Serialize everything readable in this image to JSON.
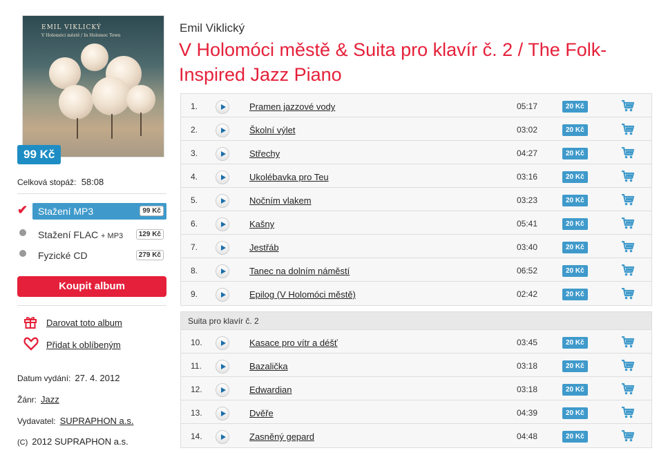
{
  "album": {
    "artist": "Emil Viklický",
    "title": "V Holomóci městě & Suita pro klavír č. 2 / The Folk-Inspired Jazz Piano",
    "price": "99 Kč",
    "cover": {
      "artist_text": "EMIL VIKLICKÝ",
      "subtitle_text": "V Holomóci městě / In Holomoc Town"
    },
    "duration_label": "Celková stopáž:",
    "duration_value": "58:08"
  },
  "formats": [
    {
      "label": "Stažení MP3",
      "suffix": "",
      "price": "99 Kč",
      "selected": true
    },
    {
      "label": "Stažení FLAC",
      "suffix": "+ MP3",
      "price": "129 Kč",
      "selected": false
    },
    {
      "label": "Fyzické CD",
      "suffix": "",
      "price": "279 Kč",
      "selected": false
    }
  ],
  "buy_label": "Koupit album",
  "actions": {
    "gift_label": "Darovat toto album",
    "favorite_label": "Přidat k oblíbeným"
  },
  "meta": {
    "release_label": "Datum vydání:",
    "release_value": "27. 4. 2012",
    "genre_label": "Žánr:",
    "genre_value": "Jazz",
    "publisher_label": "Vydavatel:",
    "publisher_value": "SUPRAPHON a.s.",
    "copyright_symbol": "(C)",
    "copyright_value": "2012 SUPRAPHON a.s."
  },
  "tracks_part1": [
    {
      "no": "1.",
      "name": "Pramen jazzové vody",
      "time": "05:17",
      "price": "20 Kč"
    },
    {
      "no": "2.",
      "name": "Školní výlet",
      "time": "03:02",
      "price": "20 Kč"
    },
    {
      "no": "3.",
      "name": "Střechy",
      "time": "04:27",
      "price": "20 Kč"
    },
    {
      "no": "4.",
      "name": "Ukolébavka pro Teu",
      "time": "03:16",
      "price": "20 Kč"
    },
    {
      "no": "5.",
      "name": "Nočním vlakem",
      "time": "03:23",
      "price": "20 Kč"
    },
    {
      "no": "6.",
      "name": "Kašny",
      "time": "05:41",
      "price": "20 Kč"
    },
    {
      "no": "7.",
      "name": "Jestřáb",
      "time": "03:40",
      "price": "20 Kč"
    },
    {
      "no": "8.",
      "name": "Tanec na dolním náměstí",
      "time": "06:52",
      "price": "20 Kč"
    },
    {
      "no": "9.",
      "name": "Epilog (V Holomóci městě)",
      "time": "02:42",
      "price": "20 Kč"
    }
  ],
  "section2_title": "Suita pro klavír č. 2",
  "tracks_part2": [
    {
      "no": "10.",
      "name": "Kasace pro vítr a déšť",
      "time": "03:45",
      "price": "20 Kč"
    },
    {
      "no": "11.",
      "name": "Bazalička",
      "time": "03:18",
      "price": "20 Kč"
    },
    {
      "no": "12.",
      "name": "Edwardian",
      "time": "03:18",
      "price": "20 Kč"
    },
    {
      "no": "13.",
      "name": "Dvěře",
      "time": "04:39",
      "price": "20 Kč"
    },
    {
      "no": "14.",
      "name": "Zasněný gepard",
      "time": "04:48",
      "price": "20 Kč"
    }
  ],
  "colors": {
    "accent_red": "#e5203a",
    "accent_blue": "#3f9acb",
    "badge_blue": "#1e8dc4"
  },
  "icons": {
    "play": "play-icon",
    "cart": "cart-icon",
    "gift": "gift-icon",
    "heart": "heart-icon",
    "check": "check-icon"
  }
}
